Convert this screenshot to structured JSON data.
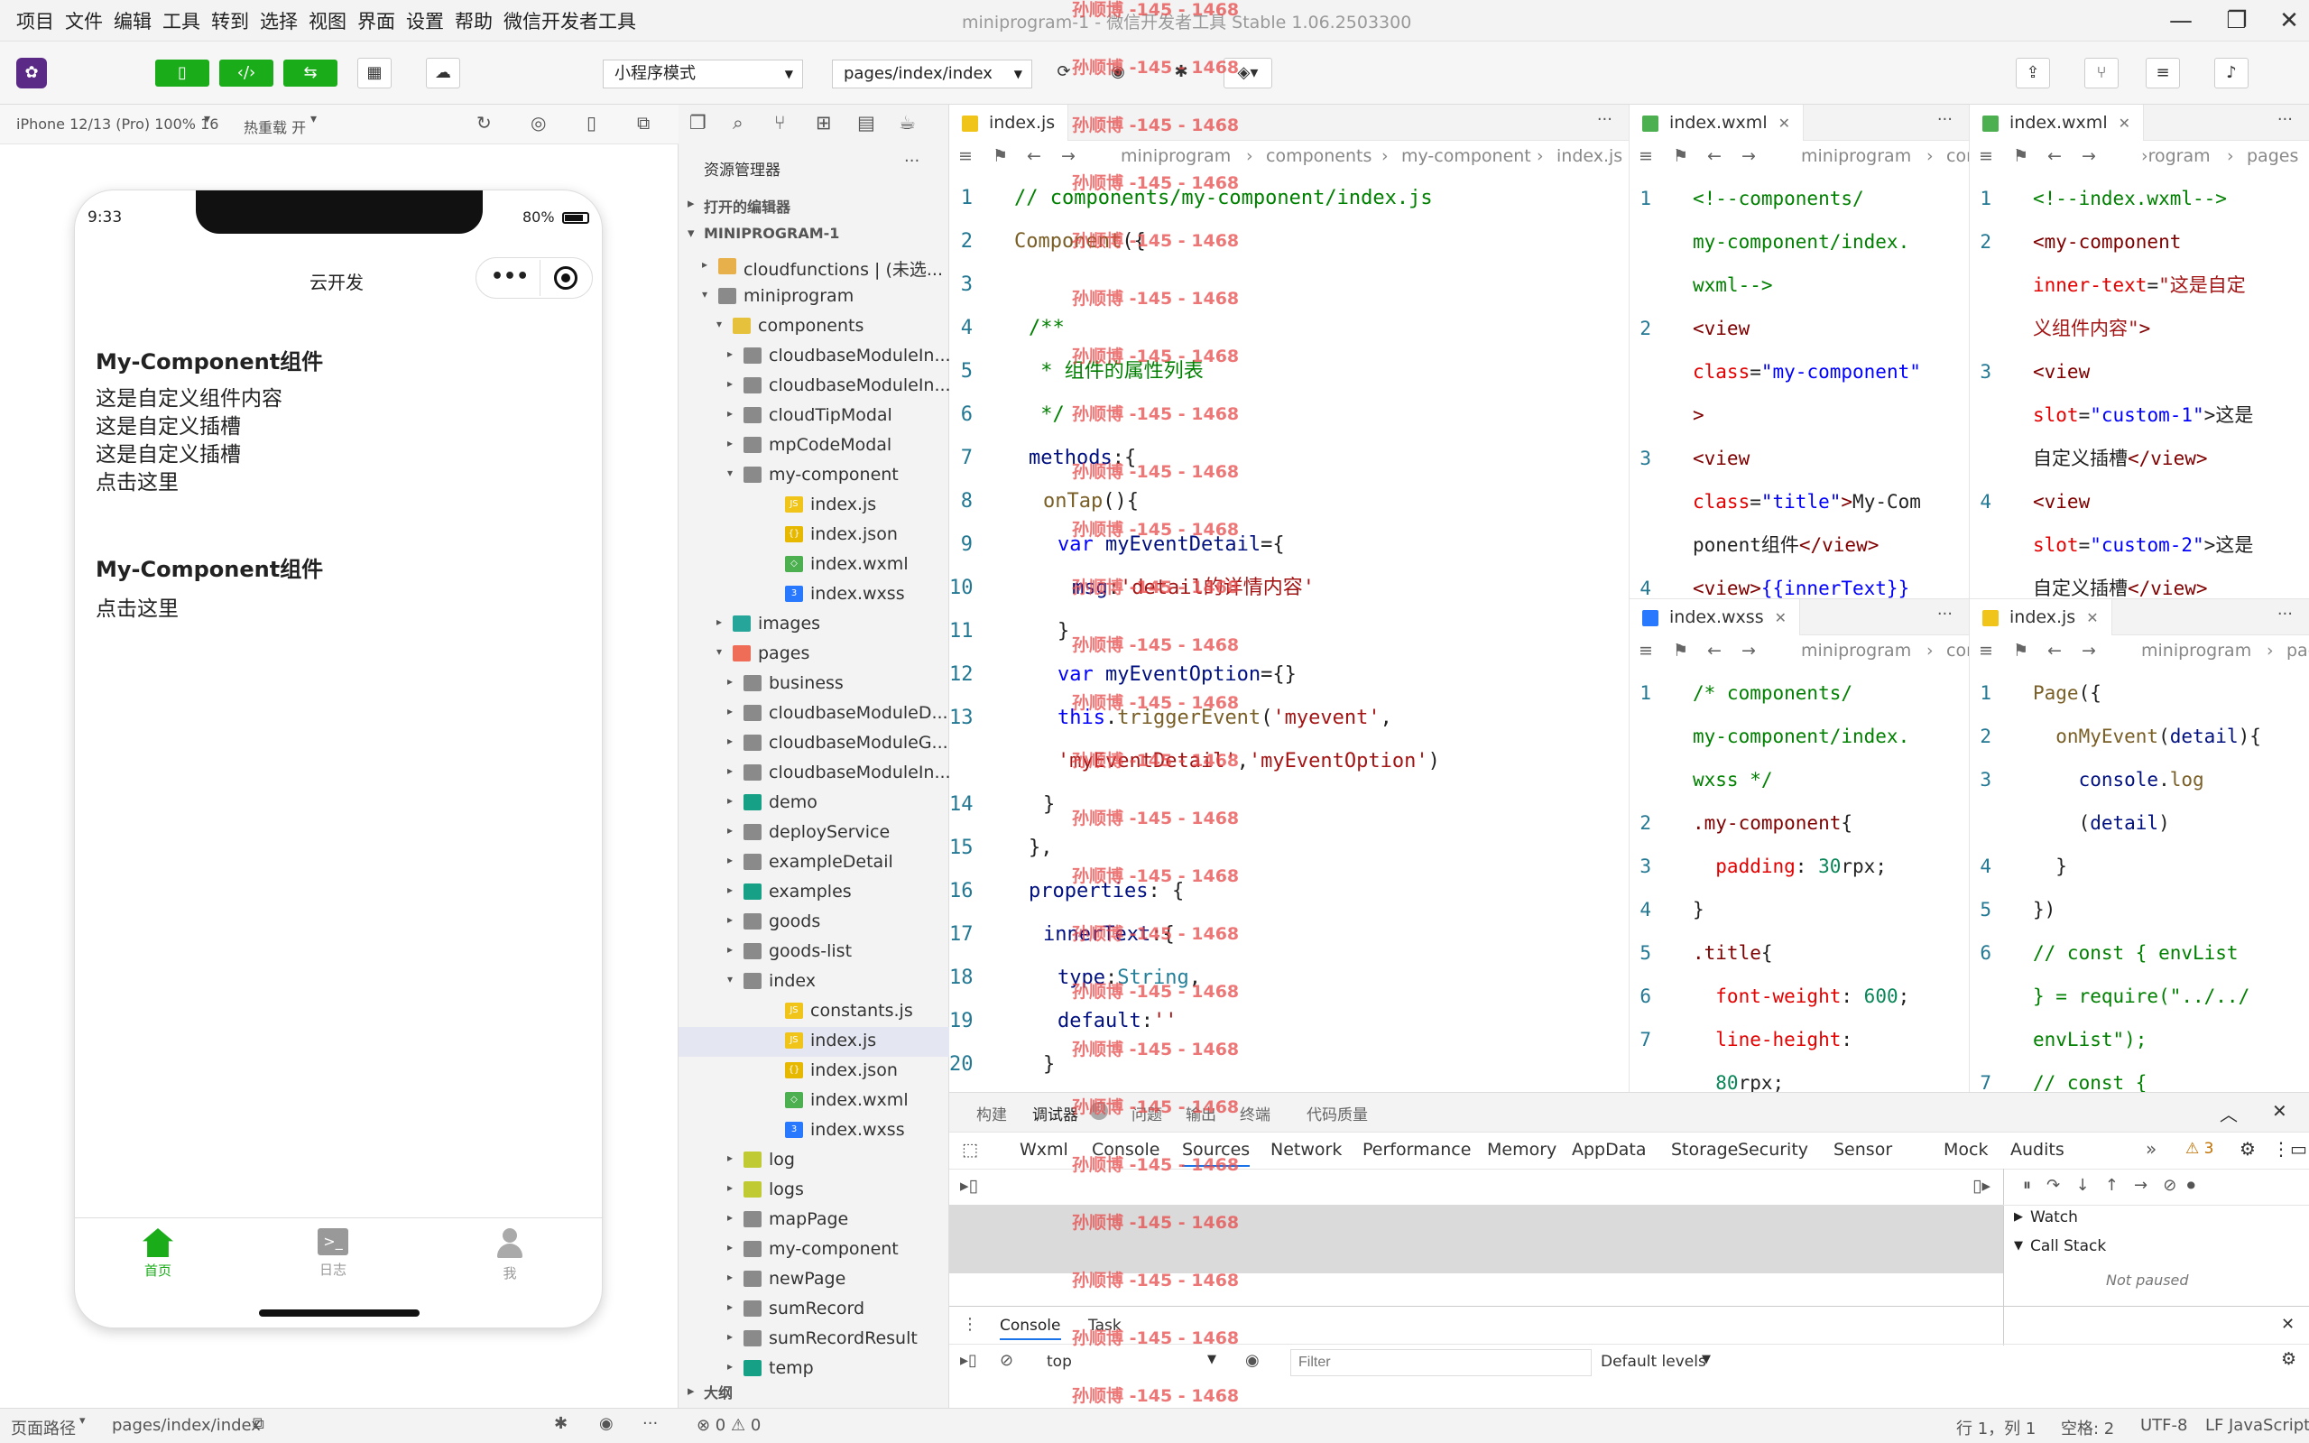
{
  "menu": [
    "项目",
    "文件",
    "编辑",
    "工具",
    "转到",
    "选择",
    "视图",
    "界面",
    "设置",
    "帮助",
    "微信开发者工具"
  ],
  "window_title": "miniprogram-1 - 微信开发者工具 Stable 1.06.2503300",
  "toolbar": {
    "mode": "小程序模式",
    "page": "pages/index/index"
  },
  "simbar": {
    "device": "iPhone 12/13 (Pro) 100% 16",
    "hotreload": "热重载 开"
  },
  "phone": {
    "time": "9:33",
    "battery": "80%",
    "nav_title": "云开发",
    "menu_dots": "•••",
    "h1": "My-Component组件",
    "lines": [
      "这是自定义组件内容",
      "这是自定义插槽",
      "这是自定义插槽",
      "点击这里"
    ],
    "h2": "My-Component组件",
    "line2": "点击这里",
    "tabs": [
      {
        "label": "首页"
      },
      {
        "label": "日志"
      },
      {
        "label": "我"
      }
    ]
  },
  "explorer": {
    "title": "资源管理器",
    "open_editors": "打开的编辑器",
    "project": "MINIPROGRAM-1",
    "rows": [
      {
        "d": 1,
        "t": "f",
        "o": 0,
        "c": "#e8b04a",
        "l": "cloudfunctions | (未选..."
      },
      {
        "d": 1,
        "t": "f",
        "o": 1,
        "c": "#8a8a8a",
        "l": "miniprogram"
      },
      {
        "d": 2,
        "t": "f",
        "o": 1,
        "c": "#e6c13c",
        "l": "components"
      },
      {
        "d": 3,
        "t": "f",
        "o": 0,
        "c": "#8a8a8a",
        "l": "cloudbaseModuleIn..."
      },
      {
        "d": 3,
        "t": "f",
        "o": 0,
        "c": "#8a8a8a",
        "l": "cloudbaseModuleIn..."
      },
      {
        "d": 3,
        "t": "f",
        "o": 0,
        "c": "#8a8a8a",
        "l": "cloudTipModal"
      },
      {
        "d": 3,
        "t": "f",
        "o": 0,
        "c": "#8a8a8a",
        "l": "mpCodeModal"
      },
      {
        "d": 3,
        "t": "f",
        "o": 1,
        "c": "#8a8a8a",
        "l": "my-component"
      },
      {
        "d": 4,
        "t": "js",
        "c": "#f0c419",
        "l": "index.js"
      },
      {
        "d": 4,
        "t": "json",
        "c": "#e6b800",
        "l": "index.json"
      },
      {
        "d": 4,
        "t": "wxml",
        "c": "#4caf50",
        "l": "index.wxml"
      },
      {
        "d": 4,
        "t": "wxss",
        "c": "#2979ff",
        "l": "index.wxss"
      },
      {
        "d": 2,
        "t": "f",
        "o": 0,
        "c": "#26a69a",
        "l": "images"
      },
      {
        "d": 2,
        "t": "f",
        "o": 1,
        "c": "#ef6c57",
        "l": "pages"
      },
      {
        "d": 3,
        "t": "f",
        "o": 0,
        "c": "#8a8a8a",
        "l": "business"
      },
      {
        "d": 3,
        "t": "f",
        "o": 0,
        "c": "#8a8a8a",
        "l": "cloudbaseModuleD..."
      },
      {
        "d": 3,
        "t": "f",
        "o": 0,
        "c": "#8a8a8a",
        "l": "cloudbaseModuleG..."
      },
      {
        "d": 3,
        "t": "f",
        "o": 0,
        "c": "#8a8a8a",
        "l": "cloudbaseModuleIn..."
      },
      {
        "d": 3,
        "t": "f",
        "o": 0,
        "c": "#16a085",
        "l": "demo"
      },
      {
        "d": 3,
        "t": "f",
        "o": 0,
        "c": "#8a8a8a",
        "l": "deployService"
      },
      {
        "d": 3,
        "t": "f",
        "o": 0,
        "c": "#8a8a8a",
        "l": "exampleDetail"
      },
      {
        "d": 3,
        "t": "f",
        "o": 0,
        "c": "#16a085",
        "l": "examples"
      },
      {
        "d": 3,
        "t": "f",
        "o": 0,
        "c": "#8a8a8a",
        "l": "goods"
      },
      {
        "d": 3,
        "t": "f",
        "o": 0,
        "c": "#8a8a8a",
        "l": "goods-list"
      },
      {
        "d": 3,
        "t": "f",
        "o": 1,
        "c": "#8a8a8a",
        "l": "index"
      },
      {
        "d": 4,
        "t": "js",
        "c": "#f0c419",
        "l": "constants.js"
      },
      {
        "d": 4,
        "t": "js",
        "c": "#f0c419",
        "l": "index.js",
        "sel": 1
      },
      {
        "d": 4,
        "t": "json",
        "c": "#e6b800",
        "l": "index.json"
      },
      {
        "d": 4,
        "t": "wxml",
        "c": "#4caf50",
        "l": "index.wxml"
      },
      {
        "d": 4,
        "t": "wxss",
        "c": "#2979ff",
        "l": "index.wxss"
      },
      {
        "d": 3,
        "t": "f",
        "o": 0,
        "c": "#c0ca33",
        "l": "log"
      },
      {
        "d": 3,
        "t": "f",
        "o": 0,
        "c": "#c0ca33",
        "l": "logs"
      },
      {
        "d": 3,
        "t": "f",
        "o": 0,
        "c": "#8a8a8a",
        "l": "mapPage"
      },
      {
        "d": 3,
        "t": "f",
        "o": 0,
        "c": "#8a8a8a",
        "l": "my-component"
      },
      {
        "d": 3,
        "t": "f",
        "o": 0,
        "c": "#8a8a8a",
        "l": "newPage"
      },
      {
        "d": 3,
        "t": "f",
        "o": 0,
        "c": "#8a8a8a",
        "l": "sumRecord"
      },
      {
        "d": 3,
        "t": "f",
        "o": 0,
        "c": "#8a8a8a",
        "l": "sumRecordResult"
      },
      {
        "d": 3,
        "t": "f",
        "o": 0,
        "c": "#16a085",
        "l": "temp"
      }
    ],
    "outline": "大纲"
  },
  "editor_main": {
    "tab": "index.js",
    "crumbs": [
      "miniprogram",
      "components",
      "my-component",
      "index.js"
    ],
    "lines": [
      {
        "n": "1",
        "i": 0,
        "s": [
          [
            "// components/my-component/index.js",
            "cm"
          ]
        ]
      },
      {
        "n": "2",
        "i": 0,
        "s": [
          [
            "Component",
            "fn"
          ],
          [
            "({",
            "p"
          ]
        ]
      },
      {
        "n": "3",
        "i": 1,
        "s": []
      },
      {
        "n": "4",
        "i": 1,
        "s": [
          [
            "/**",
            "cm"
          ]
        ]
      },
      {
        "n": "5",
        "i": 1,
        "s": [
          [
            " * 组件的属性列表",
            "cm"
          ]
        ]
      },
      {
        "n": "6",
        "i": 1,
        "s": [
          [
            " */",
            "cm"
          ]
        ]
      },
      {
        "n": "7",
        "i": 1,
        "s": [
          [
            "methods",
            "pr"
          ],
          [
            ":{",
            "p"
          ]
        ]
      },
      {
        "n": "8",
        "i": 2,
        "s": [
          [
            "onTap",
            "fn"
          ],
          [
            "(){",
            "p"
          ]
        ]
      },
      {
        "n": "9",
        "i": 3,
        "s": [
          [
            "var ",
            "kw"
          ],
          [
            "myEventDetail",
            "pr"
          ],
          [
            "={",
            "p"
          ]
        ]
      },
      {
        "n": "10",
        "i": 4,
        "s": [
          [
            "msg",
            "pr"
          ],
          [
            ":",
            "p"
          ],
          [
            "'detail的详情内容'",
            "str"
          ]
        ]
      },
      {
        "n": "11",
        "i": 3,
        "s": [
          [
            "}",
            "p"
          ]
        ]
      },
      {
        "n": "12",
        "i": 3,
        "s": [
          [
            "var ",
            "kw"
          ],
          [
            "myEventOption",
            "pr"
          ],
          [
            "={}",
            "p"
          ]
        ]
      },
      {
        "n": "13",
        "i": 3,
        "s": [
          [
            "this",
            "kw"
          ],
          [
            ".",
            "p"
          ],
          [
            "triggerEvent",
            "fn"
          ],
          [
            "(",
            "p"
          ],
          [
            "'myevent'",
            "str"
          ],
          [
            ",",
            "p"
          ]
        ]
      },
      {
        "n": "",
        "i": 3,
        "s": [
          [
            "'myEventDetail'",
            "str"
          ],
          [
            ",",
            "p"
          ],
          [
            "'myEventOption'",
            "str"
          ],
          [
            ")",
            "p"
          ]
        ]
      },
      {
        "n": "14",
        "i": 2,
        "s": [
          [
            "}",
            "p"
          ]
        ]
      },
      {
        "n": "15",
        "i": 1,
        "s": [
          [
            "},",
            "p"
          ]
        ]
      },
      {
        "n": "16",
        "i": 1,
        "s": [
          [
            "properties",
            "pr"
          ],
          [
            ": {",
            "p"
          ]
        ]
      },
      {
        "n": "17",
        "i": 2,
        "s": [
          [
            "innerText",
            "pr"
          ],
          [
            ":{",
            "p"
          ]
        ]
      },
      {
        "n": "18",
        "i": 3,
        "s": [
          [
            "type",
            "pr"
          ],
          [
            ":",
            "p"
          ],
          [
            "String",
            "cls"
          ],
          [
            ",",
            "p"
          ]
        ]
      },
      {
        "n": "19",
        "i": 3,
        "s": [
          [
            "default",
            "pr"
          ],
          [
            ":",
            "p"
          ],
          [
            "''",
            "str"
          ]
        ]
      },
      {
        "n": "20",
        "i": 2,
        "s": [
          [
            "}",
            "p"
          ]
        ]
      }
    ]
  },
  "editor_wxml": {
    "tab": "index.wxml",
    "crumbs": [
      "miniprogram",
      "compo"
    ],
    "lines": [
      {
        "n": "1",
        "s": [
          [
            "<!--components/",
            "cm"
          ]
        ]
      },
      {
        "n": "",
        "s": [
          [
            "my-component/index.",
            "cm"
          ]
        ]
      },
      {
        "n": "",
        "s": [
          [
            "wxml-->",
            "cm"
          ]
        ]
      },
      {
        "n": "2",
        "s": [
          [
            "<view",
            "tag"
          ]
        ]
      },
      {
        "n": "",
        "s": [
          [
            "class",
            "at"
          ],
          [
            "=",
            "p"
          ],
          [
            "\"my-component\"",
            "kw"
          ]
        ]
      },
      {
        "n": "",
        "s": [
          [
            ">",
            "tag"
          ]
        ]
      },
      {
        "n": "3",
        "s": [
          [
            "<view",
            "tag"
          ]
        ]
      },
      {
        "n": "",
        "s": [
          [
            "class",
            "at"
          ],
          [
            "=",
            "p"
          ],
          [
            "\"title\"",
            "kw"
          ],
          [
            ">",
            "tag"
          ],
          [
            "My-Com",
            "p"
          ]
        ]
      },
      {
        "n": "",
        "s": [
          [
            "ponent组件",
            "p"
          ],
          [
            "</view>",
            "tag"
          ]
        ]
      },
      {
        "n": "4",
        "s": [
          [
            "<view>",
            "tag"
          ],
          [
            "{{innerText}}",
            "kw"
          ]
        ]
      }
    ]
  },
  "editor_pwxml": {
    "tab": "index.wxml",
    "crumbs": [
      "›rogram",
      "pages",
      "index"
    ],
    "lines": [
      {
        "n": "1",
        "s": [
          [
            "<!--index.wxml-->",
            "cm"
          ]
        ]
      },
      {
        "n": "2",
        "s": [
          [
            "<my-component",
            "tag"
          ]
        ]
      },
      {
        "n": "",
        "s": [
          [
            "inner-text",
            "at"
          ],
          [
            "=",
            "p"
          ],
          [
            "\"这是自定",
            "str"
          ]
        ]
      },
      {
        "n": "",
        "s": [
          [
            "义组件内容\"",
            "str"
          ],
          [
            ">",
            "tag"
          ]
        ]
      },
      {
        "n": "3",
        "s": [
          [
            "<view",
            "tag"
          ]
        ]
      },
      {
        "n": "",
        "s": [
          [
            "slot",
            "at"
          ],
          [
            "=",
            "p"
          ],
          [
            "\"custom-1\"",
            "kw"
          ],
          [
            ">这是",
            "p"
          ]
        ]
      },
      {
        "n": "",
        "s": [
          [
            "自定义插槽",
            "p"
          ],
          [
            "</view>",
            "tag"
          ]
        ]
      },
      {
        "n": "4",
        "s": [
          [
            "<view",
            "tag"
          ]
        ]
      },
      {
        "n": "",
        "s": [
          [
            "slot",
            "at"
          ],
          [
            "=",
            "p"
          ],
          [
            "\"custom-2\"",
            "kw"
          ],
          [
            ">这是",
            "p"
          ]
        ]
      },
      {
        "n": "",
        "s": [
          [
            "自定义插槽",
            "p"
          ],
          [
            "</view>",
            "tag"
          ]
        ]
      }
    ]
  },
  "editor_wxss": {
    "tab": "index.wxss",
    "crumbs": [
      "miniprogram",
      "compo"
    ],
    "lines": [
      {
        "n": "1",
        "s": [
          [
            "/* components/",
            "cm"
          ]
        ]
      },
      {
        "n": "",
        "s": [
          [
            "my-component/index.",
            "cm"
          ]
        ]
      },
      {
        "n": "",
        "s": [
          [
            "wxss */",
            "cm"
          ]
        ]
      },
      {
        "n": "2",
        "s": [
          [
            ".my-component",
            "tag"
          ],
          [
            "{",
            "p"
          ]
        ]
      },
      {
        "n": "3",
        "s": [
          [
            "  padding",
            "at"
          ],
          [
            ": ",
            "p"
          ],
          [
            "30",
            "num"
          ],
          [
            "rpx;",
            "p"
          ]
        ]
      },
      {
        "n": "4",
        "s": [
          [
            "}",
            "p"
          ]
        ]
      },
      {
        "n": "5",
        "s": [
          [
            ".title",
            "tag"
          ],
          [
            "{",
            "p"
          ]
        ]
      },
      {
        "n": "6",
        "s": [
          [
            "  font-weight",
            "at"
          ],
          [
            ": ",
            "p"
          ],
          [
            "600",
            "num"
          ],
          [
            ";",
            "p"
          ]
        ]
      },
      {
        "n": "7",
        "s": [
          [
            "  line-height",
            "at"
          ],
          [
            ":",
            "p"
          ]
        ]
      },
      {
        "n": "",
        "s": [
          [
            "  80",
            "num"
          ],
          [
            "rpx;",
            "p"
          ]
        ]
      }
    ]
  },
  "editor_pjs": {
    "tab": "index.js",
    "crumbs": [
      "miniprogram",
      "pages"
    ],
    "lines": [
      {
        "n": "1",
        "s": [
          [
            "Page",
            "fn"
          ],
          [
            "({",
            "p"
          ]
        ]
      },
      {
        "n": "2",
        "s": [
          [
            "  onMyEvent",
            "fn"
          ],
          [
            "(",
            "p"
          ],
          [
            "detail",
            "pr"
          ],
          [
            "){",
            "p"
          ]
        ]
      },
      {
        "n": "3",
        "s": [
          [
            "    console",
            "pr"
          ],
          [
            ".",
            "p"
          ],
          [
            "log",
            "fn"
          ]
        ]
      },
      {
        "n": "",
        "s": [
          [
            "    (",
            "p"
          ],
          [
            "detail",
            "pr"
          ],
          [
            ")",
            "p"
          ]
        ]
      },
      {
        "n": "4",
        "s": [
          [
            "  }",
            "p"
          ]
        ]
      },
      {
        "n": "5",
        "s": [
          [
            "})",
            "p"
          ]
        ]
      },
      {
        "n": "6",
        "s": [
          [
            "// const { envList",
            "cm"
          ]
        ]
      },
      {
        "n": "",
        "s": [
          [
            "} = require(\"../../",
            "cm"
          ]
        ]
      },
      {
        "n": "",
        "s": [
          [
            "envList\");",
            "cm"
          ]
        ]
      },
      {
        "n": "7",
        "s": [
          [
            "// const {",
            "cm"
          ]
        ]
      }
    ]
  },
  "debugger": {
    "top_tabs": [
      "构建",
      "调试器",
      "问题",
      "输出",
      "终端",
      "代码质量"
    ],
    "badge": "3",
    "tabs": [
      "Wxml",
      "Console",
      "Sources",
      "Network",
      "Performance",
      "Memory",
      "AppData",
      "Storage",
      "Security",
      "Sensor",
      "Mock",
      "Audits"
    ],
    "warn": "⚠ 3",
    "watch": "Watch",
    "callstack": "Call Stack",
    "not_paused": "Not paused",
    "console_tabs": [
      "Console",
      "Task"
    ],
    "context": "top",
    "filter_placeholder": "Filter",
    "levels": "Default levels"
  },
  "statusbar": {
    "path_label": "页面路径",
    "path": "pages/index/index",
    "errors": "⊗ 0 ⚠ 0",
    "cursor": "行 1，列 1",
    "spaces": "空格: 2",
    "enc": "UTF-8",
    "eol": "LF",
    "lang": "JavaScript"
  },
  "watermark": "孙顺博 -145 - 1468",
  "colors": {
    "accent": "#1aad19",
    "selected": "#e4e6f1"
  }
}
